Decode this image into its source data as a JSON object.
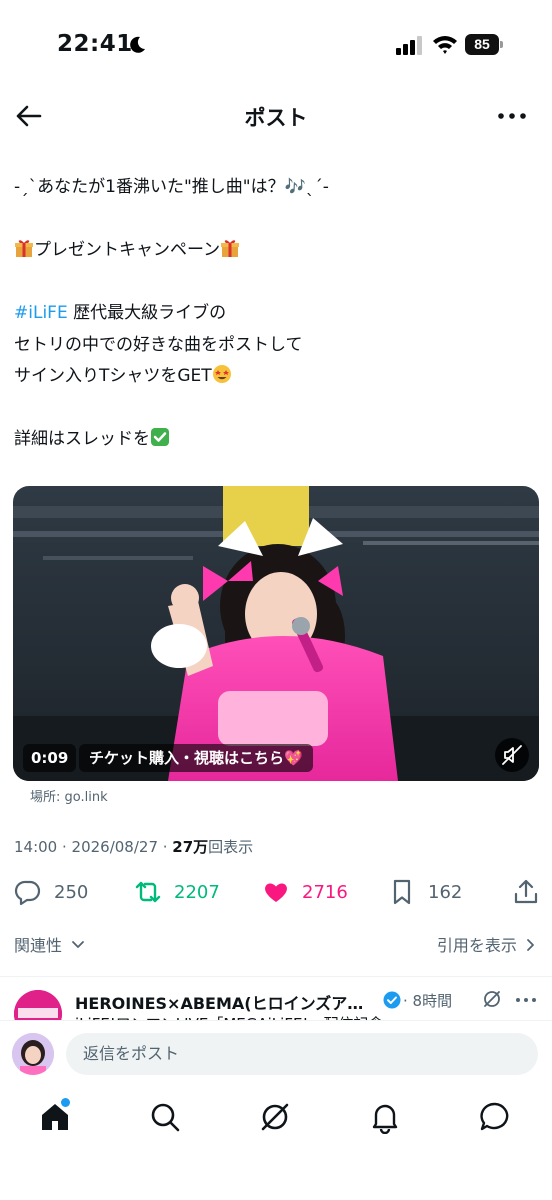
{
  "status_bar": {
    "time": "22:41",
    "battery": "85",
    "icons": [
      "moon-icon",
      "signal-icon",
      "wifi-icon",
      "battery-icon"
    ]
  },
  "header": {
    "title": "ポスト",
    "back_icon": "arrow-left-icon",
    "more_icon": "more-horizontal-icon"
  },
  "post": {
    "line1": "-ˏˋあなたが1番沸いた\"推し曲\"は？🎶ˎˊ-",
    "line2": "プレゼントキャンペーン",
    "hashtag": "#iLiFE",
    "line3_rest": " 歴代最大級ライブの",
    "line4": "セトリの中での好きな曲をポストして",
    "line5": "サイン入りTシャツをGET",
    "line6": "詳細はスレッドを",
    "media": {
      "duration": "0:09",
      "cta": "チケット購入・視聴はこちら💖",
      "location": "場所: go.link"
    },
    "meta_time": "14:00 · 2026/08/27 · ",
    "meta_views_count": "27万",
    "meta_views_label": "回表示"
  },
  "actions": {
    "replies": "250",
    "reposts": "2207",
    "likes": "2716",
    "bookmarks": "162",
    "colors": {
      "repost": "#00ba7c",
      "like": "#f91880",
      "muted": "#536471"
    }
  },
  "related": {
    "label": "関連性",
    "quotes_label": "引用を表示"
  },
  "reply_preview": {
    "name": "HEROINES×ABEMA(ヒロインズア…",
    "time": "· 8時間",
    "snippet": "iLiFE!ワンマンLIVE「MEGAiLiFE!」配信記念"
  },
  "compose": {
    "placeholder": "返信をポスト"
  },
  "tabbar": {
    "items": [
      "home-icon",
      "search-icon",
      "grok-icon",
      "notifications-icon",
      "messages-icon"
    ]
  },
  "accent_color": "#1d9bf0"
}
